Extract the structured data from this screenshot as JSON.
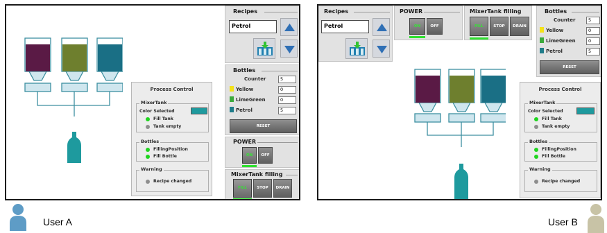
{
  "users": {
    "a_label": "User A",
    "b_label": "User B"
  },
  "colors": {
    "yellow": "#f4e21a",
    "limegreen": "#3caa3c",
    "petrol": "#1f7c8a",
    "tank1": "#5a1a45",
    "tank2": "#6e7f2e",
    "tank3": "#1a6f85",
    "selected_color": "#1e9a9e",
    "bottle": "#1e9a9e"
  },
  "recipes": {
    "title": "Recipes",
    "value": "Petrol"
  },
  "bottles": {
    "title": "Bottles",
    "rows": [
      {
        "label": "Counter",
        "value": "5"
      },
      {
        "label": "Yellow",
        "value": "0"
      },
      {
        "label": "LimeGreen",
        "value": "0"
      },
      {
        "label": "Petrol",
        "value": "5"
      }
    ],
    "reset_label": "RESET"
  },
  "power": {
    "title": "POWER",
    "on_label": "ON",
    "off_label": "OFF"
  },
  "mixer_filling": {
    "title": "MixerTank filling",
    "fill_label": "FILL",
    "stop_label": "STOP",
    "drain_label": "DRAIN"
  },
  "process_control": {
    "title": "Process Control",
    "mixer": {
      "title": "MixerTank",
      "color_selected": "Color Selected",
      "fill_tank": "Fill Tank",
      "tank_empty": "Tank empty"
    },
    "bottles": {
      "title": "Bottles",
      "filling_position": "FillingPosition",
      "fill_bottle": "Fill Bottle"
    },
    "warning": {
      "title": "Warning",
      "recipe_changed": "Recipe changed"
    }
  }
}
